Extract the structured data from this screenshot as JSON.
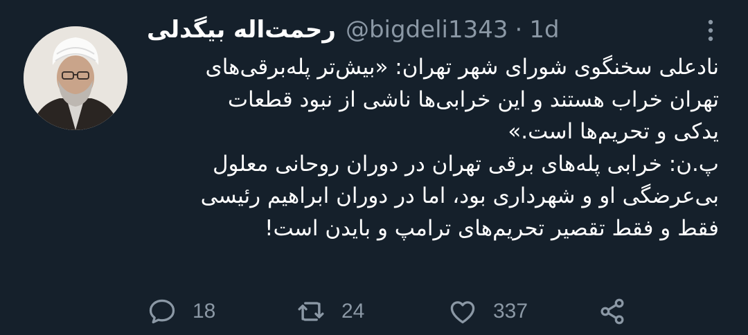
{
  "author": {
    "display_name": "رحمت‌اله بیگدلی",
    "handle": "@bigdeli1343",
    "separator": "·",
    "age": "1d"
  },
  "tweet": {
    "lines": [
      "نادعلی سخنگوی شورای شهر تهران: «بیش‌تر پله‌برقی‌های",
      "تهران خراب هستند و این خرابی‌ها ناشی از نبود قطعات",
      "یدکی و تحریم‌ها است.»",
      "پ.ن: خرابی پله‌های برقی تهران در دوران روحانی معلول",
      "بی‌عرضگی او و شهرداری بود، اما در دوران ابراهیم رئیسی",
      "فقط و فقط تقصیر تحریم‌های ترامپ  و بایدن است!"
    ]
  },
  "actions": {
    "reply_count": "18",
    "retweet_count": "24",
    "like_count": "337"
  },
  "icons": {
    "more": "more-vertical-icon",
    "reply": "reply-icon",
    "retweet": "retweet-icon",
    "like": "heart-icon",
    "share": "share-icon"
  },
  "colors": {
    "background": "#15202b",
    "text": "#ffffff",
    "muted": "#8b98a5"
  }
}
